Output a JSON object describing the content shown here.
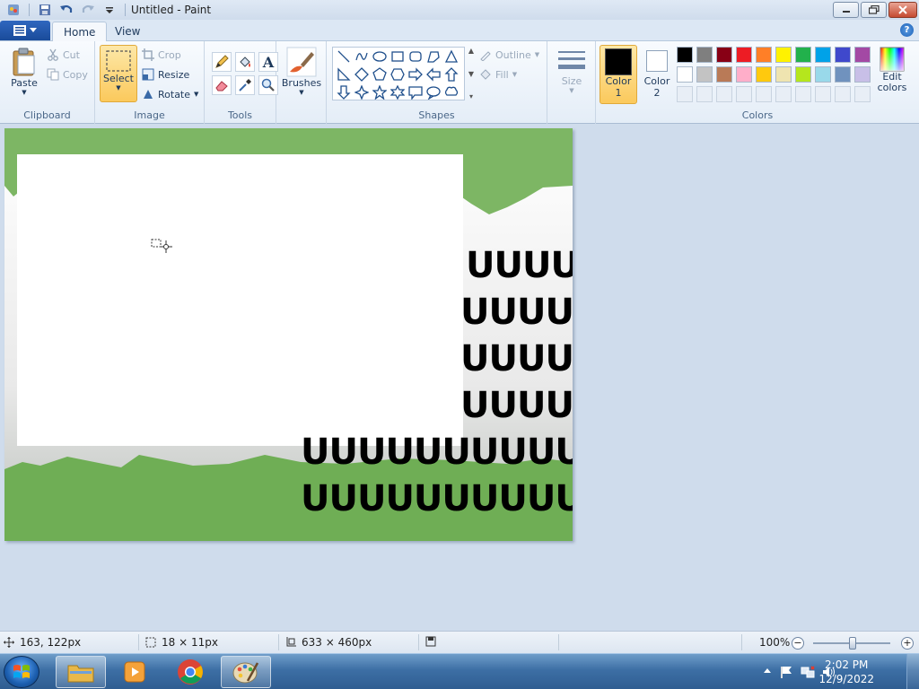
{
  "window": {
    "title": "Untitled - Paint"
  },
  "tabs": {
    "home": "Home",
    "view": "View"
  },
  "clipboard": {
    "paste": "Paste",
    "cut": "Cut",
    "copy": "Copy",
    "label": "Clipboard"
  },
  "image": {
    "select": "Select",
    "crop": "Crop",
    "resize": "Resize",
    "rotate": "Rotate",
    "label": "Image"
  },
  "tools": {
    "label": "Tools"
  },
  "brushes": {
    "label": "Brushes"
  },
  "shapes": {
    "outline": "Outline",
    "fill": "Fill",
    "label": "Shapes"
  },
  "size": {
    "label": "Size"
  },
  "colors": {
    "color1": "Color",
    "color1_num": "1",
    "color2": "Color",
    "color2_num": "2",
    "edit": "Edit colors",
    "label": "Colors",
    "color1_value": "#000000",
    "color2_value": "#ffffff",
    "palette_row1": [
      "#000000",
      "#7f7f7f",
      "#880015",
      "#ed1c24",
      "#ff7f27",
      "#fff200",
      "#22b14c",
      "#00a2e8",
      "#3f48cc",
      "#a349a4"
    ],
    "palette_row2": [
      "#ffffff",
      "#c3c3c3",
      "#b97a57",
      "#ffaec9",
      "#ffc90e",
      "#efe4b0",
      "#b5e61d",
      "#99d9ea",
      "#7092be",
      "#c8bfe7"
    ]
  },
  "canvas_text": {
    "row1": "UUUU",
    "row2": "UUUUU",
    "row3": "UUUUU",
    "row4": "UUUUU",
    "row5": "UUUUUUUUUUU",
    "row6": "UUUUUUUUUU"
  },
  "status": {
    "cursor_pos": "163, 122px",
    "selection_size": "18 × 11px",
    "image_size": "633 × 460px",
    "zoom": "100%"
  },
  "taskbar": {
    "time": "2:02 PM",
    "date": "12/9/2022"
  }
}
